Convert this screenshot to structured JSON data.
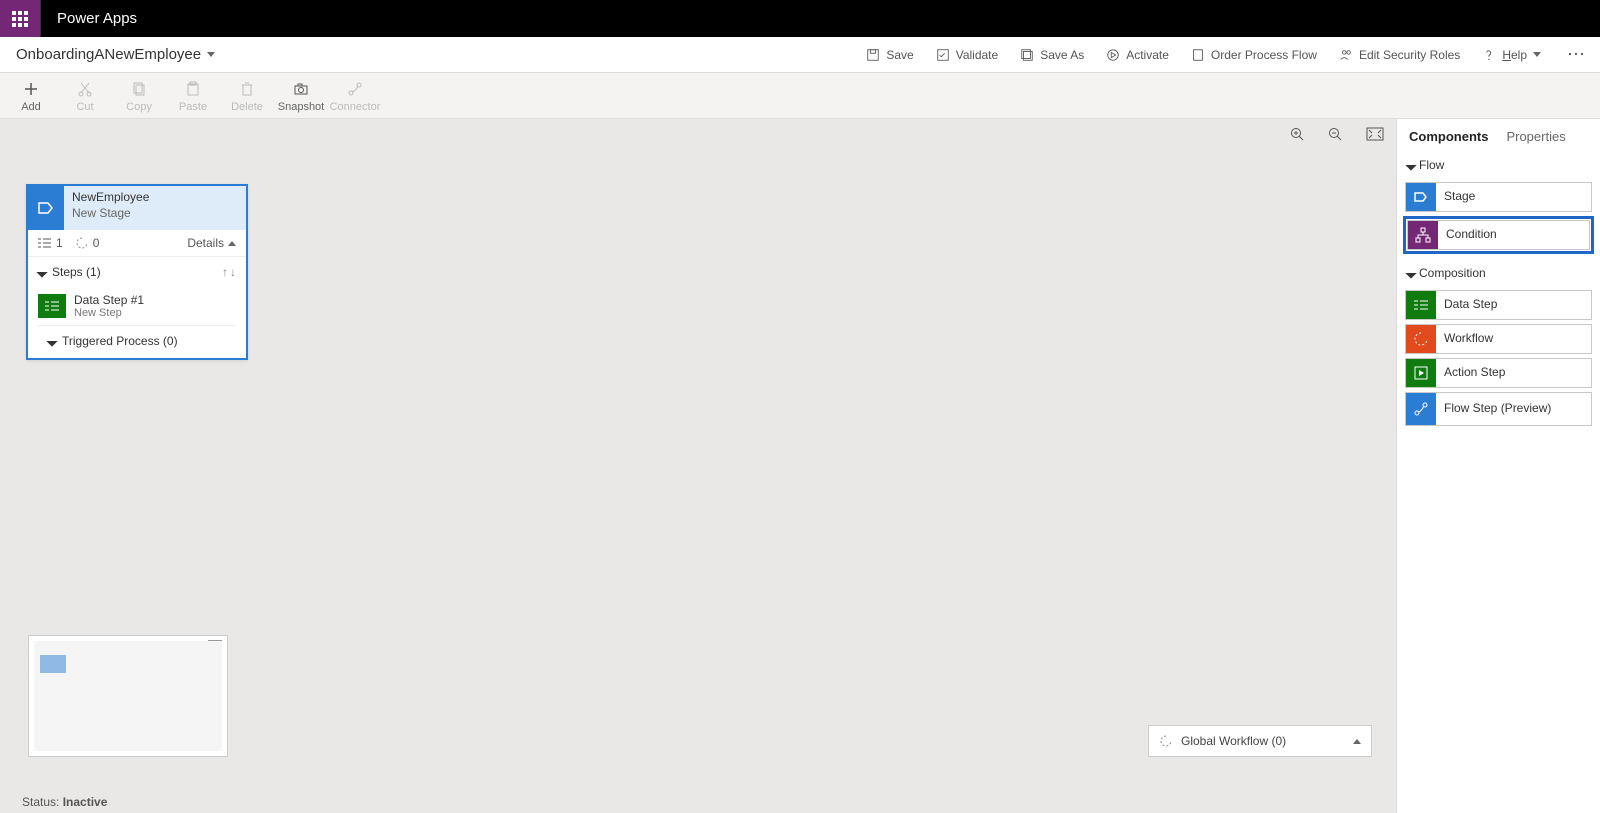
{
  "titlebar": {
    "app_name": "Power Apps"
  },
  "cmdbar": {
    "flow_name": "OnboardingANewEmployee",
    "save": "Save",
    "validate": "Validate",
    "save_as": "Save As",
    "activate": "Activate",
    "order": "Order Process Flow",
    "security": "Edit Security Roles",
    "help": "Help"
  },
  "toolbar": {
    "add": "Add",
    "cut": "Cut",
    "copy": "Copy",
    "paste": "Paste",
    "delete": "Delete",
    "snapshot": "Snapshot",
    "connector": "Connector"
  },
  "stage": {
    "entity": "NewEmployee",
    "name": "New Stage",
    "step_count": "1",
    "workflow_count": "0",
    "details_label": "Details",
    "steps_header": "Steps (1)",
    "step1_name": "Data Step #1",
    "step1_sub": "New Step",
    "triggered": "Triggered Process (0)"
  },
  "global_workflow": "Global Workflow (0)",
  "status_label": "Status:",
  "status_value": "Inactive",
  "side": {
    "tab_components": "Components",
    "tab_properties": "Properties",
    "group_flow": "Flow",
    "group_comp": "Composition",
    "item_stage": "Stage",
    "item_condition": "Condition",
    "item_datastep": "Data Step",
    "item_workflow": "Workflow",
    "item_actionstep": "Action Step",
    "item_flowstep": "Flow Step (Preview)"
  }
}
